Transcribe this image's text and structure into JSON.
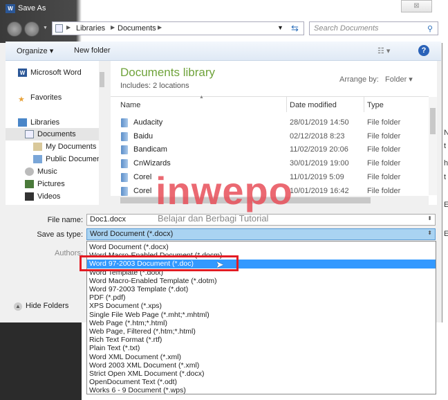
{
  "window": {
    "title": "Save As",
    "close": "⊠"
  },
  "address": {
    "crumbs": [
      "Libraries",
      "Documents"
    ],
    "search_placeholder": "Search Documents"
  },
  "toolbar": {
    "organize": "Organize ▾",
    "new_folder": "New folder"
  },
  "nav": {
    "items": [
      "Microsoft Word",
      "Favorites",
      "Libraries",
      "Documents",
      "My Documents",
      "Public Documents",
      "Music",
      "Pictures",
      "Videos"
    ]
  },
  "library": {
    "title": "Documents library",
    "subtitle": "Includes:  2 locations",
    "arrange_label": "Arrange by:",
    "arrange_value": "Folder ▾"
  },
  "columns": [
    "Name",
    "Date modified",
    "Type"
  ],
  "files": [
    {
      "name": "Audacity",
      "date": "28/01/2019 14:50",
      "type": "File folder"
    },
    {
      "name": "Baidu",
      "date": "02/12/2018 8:23",
      "type": "File folder"
    },
    {
      "name": "Bandicam",
      "date": "11/02/2019 20:06",
      "type": "File folder"
    },
    {
      "name": "CnWizards",
      "date": "30/01/2019 19:00",
      "type": "File folder"
    },
    {
      "name": "Corel",
      "date": "11/01/2019 5:09",
      "type": "File folder"
    },
    {
      "name": "Corel",
      "date": "10/01/2019 16:42",
      "type": "File folder"
    }
  ],
  "form": {
    "file_name_label": "File name:",
    "file_name": "Doc1.docx",
    "type_label": "Save as type:",
    "type_value": "Word Document (*.docx)",
    "authors_label": "Authors:",
    "hide_folders": "Hide Folders"
  },
  "type_options": [
    "Word Document (*.docx)",
    "Word Macro-Enabled Document (*.docm)",
    "Word 97-2003 Document (*.doc)",
    "Word Template (*.dotx)",
    "Word Macro-Enabled Template (*.dotm)",
    "Word 97-2003 Template (*.dot)",
    "PDF (*.pdf)",
    "XPS Document (*.xps)",
    "Single File Web Page (*.mht;*.mhtml)",
    "Web Page (*.htm;*.html)",
    "Web Page, Filtered (*.htm;*.html)",
    "Rich Text Format (*.rtf)",
    "Plain Text (*.txt)",
    "Word XML Document (*.xml)",
    "Word 2003 XML Document (*.xml)",
    "Strict Open XML Document (*.docx)",
    "OpenDocument Text (*.odt)",
    "Works 6 - 9 Document (*.wps)"
  ],
  "selected_option_index": 2,
  "watermark": {
    "logo": "inwepo",
    "tagline": "Belajar dan Berbagi Tutorial"
  },
  "background_doc": {
    "chars": [
      "N",
      "t",
      "h",
      "t",
      "E",
      "E"
    ]
  },
  "colors": {
    "highlight": "#3399ff",
    "annotation": "#e31b23",
    "library_title": "#6fa33b"
  }
}
